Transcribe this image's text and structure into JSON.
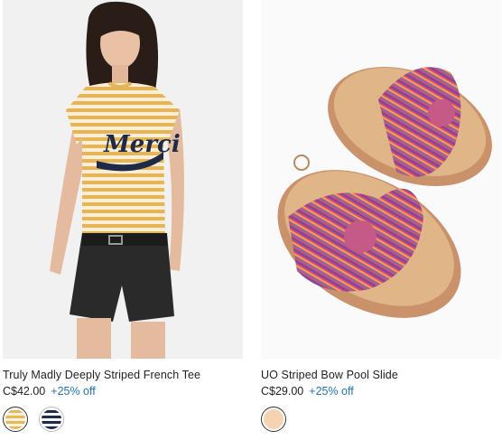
{
  "products": [
    {
      "title": "Truly Madly Deeply Striped French Tee",
      "price": "C$42.00",
      "promo": "+25% off",
      "image_alt": "Model wearing yellow striped Merci tee with black denim shorts",
      "shirt_text": "Merci",
      "swatches": [
        {
          "name": "yellow-stripe",
          "color": "#e7b75a"
        },
        {
          "name": "navy-stripe",
          "color": "#1e2a4a"
        }
      ]
    },
    {
      "title": "UO Striped Bow Pool Slide",
      "price": "C$29.00",
      "promo": "+25% off",
      "image_alt": "Pair of cork slides with multicolor striped bow straps",
      "swatches": [
        {
          "name": "tan",
          "color": "#f6d3b0"
        }
      ]
    }
  ]
}
